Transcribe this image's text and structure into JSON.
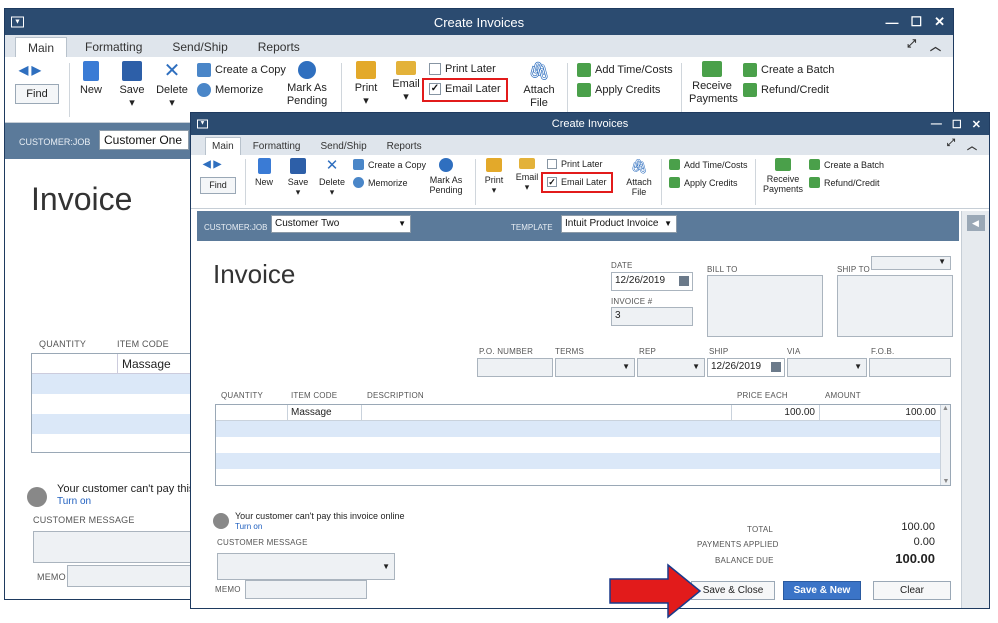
{
  "window_title": "Create Invoices",
  "tabs": [
    "Main",
    "Formatting",
    "Send/Ship",
    "Reports"
  ],
  "toolbar": {
    "find": "Find",
    "new": "New",
    "save": "Save",
    "delete": "Delete",
    "create_copy": "Create a Copy",
    "memorize": "Memorize",
    "mark_as_pending_1": "Mark As",
    "mark_as_pending_2": "Pending",
    "print": "Print",
    "email": "Email",
    "print_later": "Print Later",
    "email_later": "Email Later",
    "attach_file_1": "Attach",
    "attach_file_2": "File",
    "add_time_costs": "Add Time/Costs",
    "apply_credits": "Apply Credits",
    "receive_payments_1": "Receive",
    "receive_payments_2": "Payments",
    "create_batch": "Create a Batch",
    "refund_credit": "Refund/Credit"
  },
  "back_window": {
    "customer_job_label": "CUSTOMER:JOB",
    "customer_job_value": "Customer One",
    "invoice_title": "Invoice",
    "quantity_header": "QUANTITY",
    "item_code_header": "ITEM CODE",
    "item_row1": "Massage",
    "pay_notice": "Your customer can't pay this i",
    "turn_on": "Turn on",
    "customer_message_label": "CUSTOMER MESSAGE",
    "memo_label": "MEMO"
  },
  "front_window": {
    "customer_job_label": "CUSTOMER:JOB",
    "customer_job_value": "Customer Two",
    "template_label": "TEMPLATE",
    "template_value": "Intuit Product Invoice",
    "invoice_title": "Invoice",
    "date_label": "DATE",
    "date_value": "12/26/2019",
    "invoice_num_label": "INVOICE #",
    "invoice_num_value": "3",
    "bill_to_label": "BILL TO",
    "ship_to_label": "SHIP TO",
    "po_number_label": "P.O. NUMBER",
    "terms_label": "TERMS",
    "rep_label": "REP",
    "ship_label": "SHIP",
    "ship_value": "12/26/2019",
    "via_label": "VIA",
    "fob_label": "F.O.B.",
    "columns": [
      "QUANTITY",
      "ITEM CODE",
      "DESCRIPTION",
      "PRICE EACH",
      "AMOUNT"
    ],
    "line_item": {
      "quantity": "",
      "item_code": "Massage",
      "description": "",
      "price_each": "100.00",
      "amount": "100.00"
    },
    "pay_notice": "Your customer can't pay this invoice online",
    "turn_on": "Turn on",
    "customer_message_label": "CUSTOMER MESSAGE",
    "memo_label": "MEMO",
    "total_label": "TOTAL",
    "total_value": "100.00",
    "payments_applied_label": "PAYMENTS APPLIED",
    "payments_applied_value": "0.00",
    "balance_due_label": "BALANCE DUE",
    "balance_due_value": "100.00",
    "save_close": "Save & Close",
    "save_new": "Save & New",
    "clear": "Clear"
  },
  "colors": {
    "titlebar": "#2b4b70",
    "header_bar": "#5b7a9a",
    "highlight_red": "#e21b1b",
    "primary_button": "#3b74c7"
  }
}
